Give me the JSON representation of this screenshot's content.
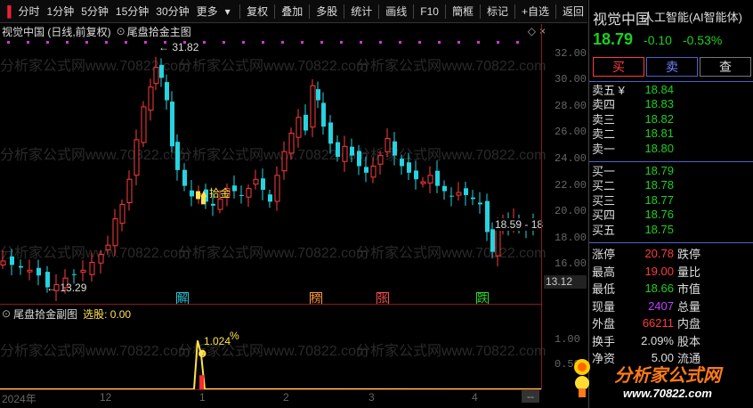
{
  "toolbar": {
    "left_items": [
      "分时",
      "1分钟",
      "5分钟",
      "15分钟",
      "30分钟",
      "更多"
    ],
    "right_items": [
      "复权",
      "叠加",
      "多股",
      "统计",
      "画线",
      "F10",
      "簡框",
      "标记",
      "+自选",
      "返回"
    ]
  },
  "main_chart": {
    "title": "视觉中国 (日线,前复权)",
    "indicator": "尾盘拾金主图",
    "high_label": "31.82",
    "low_label": "13.29",
    "last_label": "18.59 - 18",
    "signal_label": "拾金",
    "event_markers": [
      {
        "text": "解",
        "color": "#27c4d4"
      },
      {
        "text": "榜",
        "color": "#ff9a3c"
      },
      {
        "text": "张",
        "color": "#ff4d4d"
      },
      {
        "text": "跌",
        "color": "#2fd62f"
      }
    ],
    "y_ticks": [
      "32.00",
      "30.00",
      "28.00",
      "26.00",
      "24.00",
      "22.00",
      "20.00",
      "18.00",
      "16.00"
    ],
    "y_tick_values": [
      32,
      30,
      28,
      26,
      24,
      22,
      20,
      18,
      16
    ],
    "price_range": [
      13.12,
      33.2
    ],
    "current_price_tag": "13.12"
  },
  "sub_chart": {
    "title": "尾盘拾金副图",
    "stock_pick_label": "选股: 0.00",
    "value_label": "1.024",
    "unit_label": "%",
    "y_ticks": [
      "1.00",
      "0.50"
    ],
    "y_tick_values": [
      1.0,
      0.5
    ],
    "value_range": [
      0,
      1.4
    ]
  },
  "x_axis": {
    "labels": [
      "2024年",
      "12",
      "1",
      "2",
      "3",
      "4"
    ]
  },
  "quote": {
    "name": "视觉中国",
    "concept": "人工智能(AI智能体)",
    "price": "18.79",
    "change": "-0.10",
    "change_pct": "-0.53%",
    "buy_btn": "买",
    "sell_btn": "卖",
    "check_btn": "查",
    "asks": [
      {
        "label": "卖五 ¥",
        "price": "18.84"
      },
      {
        "label": "卖四",
        "price": "18.83"
      },
      {
        "label": "卖三",
        "price": "18.82"
      },
      {
        "label": "卖二",
        "price": "18.81"
      },
      {
        "label": "卖一",
        "price": "18.80"
      }
    ],
    "bids": [
      {
        "label": "买一",
        "price": "18.79"
      },
      {
        "label": "买二",
        "price": "18.78"
      },
      {
        "label": "买三",
        "price": "18.77"
      },
      {
        "label": "买四",
        "price": "18.76"
      },
      {
        "label": "买五",
        "price": "18.75"
      }
    ],
    "stats": [
      {
        "label": "涨停",
        "value": "20.78",
        "color": "#ff3b3b",
        "label2": "跌停"
      },
      {
        "label": "最高",
        "value": "19.00",
        "color": "#ff3b3b",
        "label2": "量比"
      },
      {
        "label": "最低",
        "value": "18.66",
        "color": "#1bd11b",
        "label2": "市值"
      },
      {
        "label": "现量",
        "value": "2407",
        "color": "#c040ff",
        "label2": "总量"
      },
      {
        "label": "外盘",
        "value": "66211",
        "color": "#ff3b3b",
        "label2": "内盘"
      },
      {
        "label": "换手",
        "value": "2.09%",
        "color": "#ddd",
        "label2": "股本"
      },
      {
        "label": "净资",
        "value": "5.00",
        "color": "#ddd",
        "label2": "流通"
      }
    ]
  },
  "watermark": {
    "text": "分析家公式网www.70822.com",
    "brand": "分析家公式网",
    "url": "www.70822.com"
  }
}
